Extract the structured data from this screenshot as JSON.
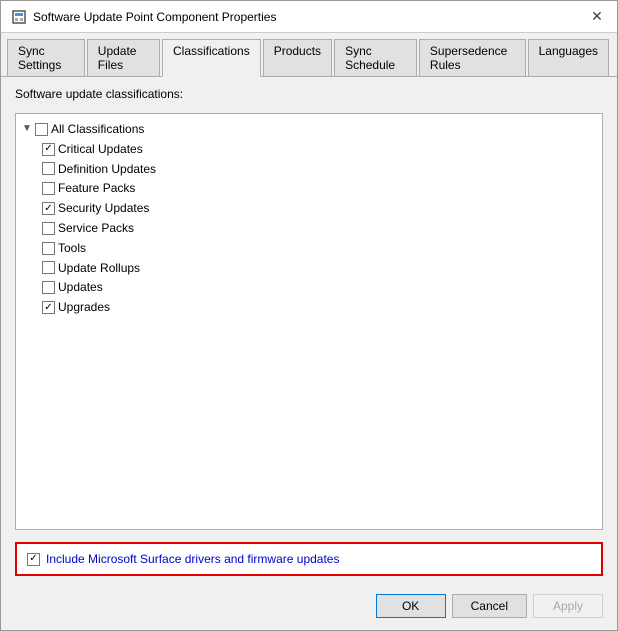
{
  "window": {
    "title": "Software Update Point Component Properties",
    "icon": "gear-icon"
  },
  "tabs": [
    {
      "id": "sync-settings",
      "label": "Sync Settings",
      "active": false
    },
    {
      "id": "update-files",
      "label": "Update Files",
      "active": false
    },
    {
      "id": "classifications",
      "label": "Classifications",
      "active": true
    },
    {
      "id": "products",
      "label": "Products",
      "active": false
    },
    {
      "id": "sync-schedule",
      "label": "Sync Schedule",
      "active": false
    },
    {
      "id": "supersedence-rules",
      "label": "Supersedence Rules",
      "active": false
    },
    {
      "id": "languages",
      "label": "Languages",
      "active": false
    }
  ],
  "classifications_tab": {
    "section_label": "Software update classifications:",
    "tree": {
      "root": {
        "label": "All Classifications",
        "expanded": true,
        "checked": false,
        "items": [
          {
            "label": "Critical Updates",
            "checked": true
          },
          {
            "label": "Definition Updates",
            "checked": false
          },
          {
            "label": "Feature Packs",
            "checked": false
          },
          {
            "label": "Security Updates",
            "checked": true
          },
          {
            "label": "Service Packs",
            "checked": false
          },
          {
            "label": "Tools",
            "checked": false
          },
          {
            "label": "Update Rollups",
            "checked": false
          },
          {
            "label": "Updates",
            "checked": false
          },
          {
            "label": "Upgrades",
            "checked": true
          }
        ]
      }
    },
    "include_surface": {
      "checked": true,
      "label_normal": "Include Microsoft Surface drivers ",
      "label_blue": "and firmware updates"
    }
  },
  "buttons": {
    "ok": "OK",
    "cancel": "Cancel",
    "apply": "Apply"
  }
}
